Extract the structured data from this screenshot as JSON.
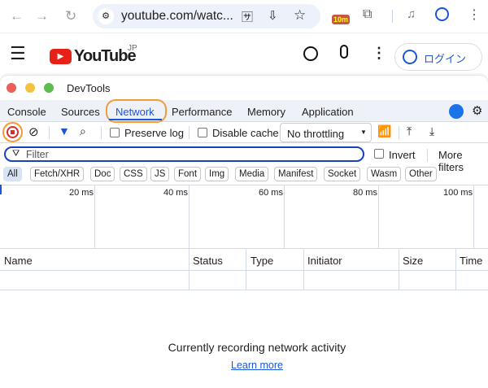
{
  "browser": {
    "url": "youtube.com/watc...",
    "badge": "10m"
  },
  "youtube": {
    "logo": "YouTube",
    "region": "JP",
    "login": "ログイン"
  },
  "devtools": {
    "title": "DevTools",
    "tabs": [
      "Console",
      "Sources",
      "Network",
      "Performance",
      "Memory",
      "Application"
    ],
    "active_tab": "Network",
    "toolbar": {
      "preserve_log": "Preserve log",
      "disable_cache": "Disable cache",
      "throttling": "No throttling"
    },
    "filter": {
      "placeholder": "Filter",
      "invert": "Invert",
      "more_filters": "More filters"
    },
    "types": [
      "All",
      "Fetch/XHR",
      "Doc",
      "CSS",
      "JS",
      "Font",
      "Img",
      "Media",
      "Manifest",
      "Socket",
      "Wasm",
      "Other"
    ],
    "timeline": [
      "20 ms",
      "40 ms",
      "60 ms",
      "80 ms",
      "100 ms"
    ],
    "columns": [
      "Name",
      "Status",
      "Type",
      "Initiator",
      "Size",
      "Time"
    ],
    "empty_message": "Currently recording network activity",
    "learn_more": "Learn more"
  },
  "colors": {
    "accent": "#1a56db",
    "highlight": "#f29c38",
    "record": "#d93025"
  }
}
